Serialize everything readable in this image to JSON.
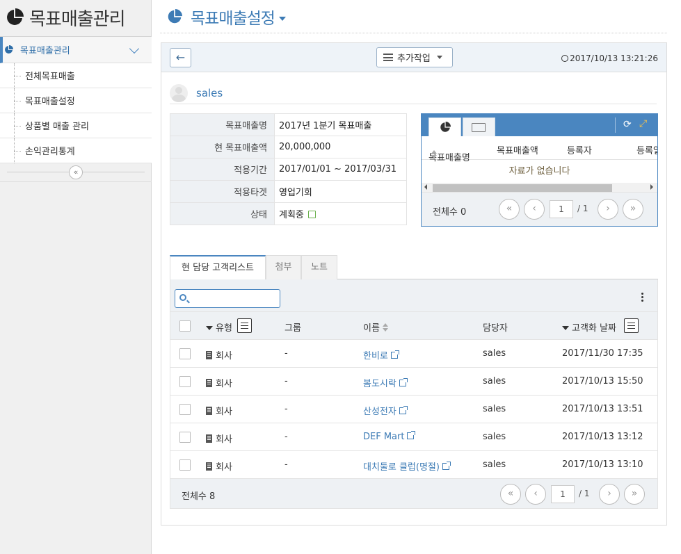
{
  "app": {
    "title": "목표매출관리"
  },
  "sidebar": {
    "main_item": "목표매출관리",
    "items": [
      {
        "label": "전체목표매출"
      },
      {
        "label": "목표매출설정"
      },
      {
        "label": "상품별 매출 관리"
      },
      {
        "label": "손익관리통계"
      }
    ],
    "collapse_symbol": "«"
  },
  "page": {
    "title": "목표매출설정"
  },
  "toolbar": {
    "back_symbol": "←",
    "extra_label": "추가작업",
    "timestamp": "2017/10/13 13:21:26"
  },
  "owner": {
    "name": "sales"
  },
  "info": [
    {
      "label": "목표매출명",
      "value": "2017년 1분기 목표매출"
    },
    {
      "label": "현 목표매출액",
      "value": "20,000,000"
    },
    {
      "label": "적용기간",
      "value": "2017/01/01 ~ 2017/03/31"
    },
    {
      "label": "적용타겟",
      "value": "영업기회"
    },
    {
      "label": "상태",
      "value": "계획중"
    }
  ],
  "history_grid": {
    "columns": [
      "목표매출명",
      "목표매출액",
      "등록자",
      "등록일"
    ],
    "empty_text": "자료가 없습니다",
    "total_label": "전체수 0",
    "page": "1",
    "page_total": "/ 1"
  },
  "tabs": [
    {
      "label": "현 담당 고객리스트",
      "active": true
    },
    {
      "label": "첨부",
      "active": false
    },
    {
      "label": "노트",
      "active": false
    }
  ],
  "customer_list": {
    "search_placeholder": "",
    "columns": {
      "type": "유형",
      "group": "그룹",
      "name": "이름",
      "owner": "담당자",
      "date": "고객화 날짜"
    },
    "rows": [
      {
        "type": "회사",
        "group": "-",
        "name": "한비로",
        "owner": "sales",
        "date": "2017/11/30 17:35"
      },
      {
        "type": "회사",
        "group": "-",
        "name": "봄도시락",
        "owner": "sales",
        "date": "2017/10/13 15:50"
      },
      {
        "type": "회사",
        "group": "-",
        "name": "산성전자",
        "owner": "sales",
        "date": "2017/10/13 13:51"
      },
      {
        "type": "회사",
        "group": "-",
        "name": "DEF Mart",
        "owner": "sales",
        "date": "2017/10/13 13:12"
      },
      {
        "type": "회사",
        "group": "-",
        "name": "대치둘로 클럽(명절)",
        "owner": "sales",
        "date": "2017/10/13 13:10"
      }
    ],
    "total_label": "전체수 8",
    "page": "1",
    "page_total": "/ 1"
  },
  "pager_symbols": {
    "first": "«",
    "prev": "‹",
    "next": "›",
    "last": "»"
  },
  "colors": {
    "accent": "#4a86c0",
    "title_blue": "#3d7bb5",
    "sidebar_bg": "#f0f0f0",
    "edit_green": "#6ab04c",
    "expand_yellow": "#f2c14e"
  }
}
